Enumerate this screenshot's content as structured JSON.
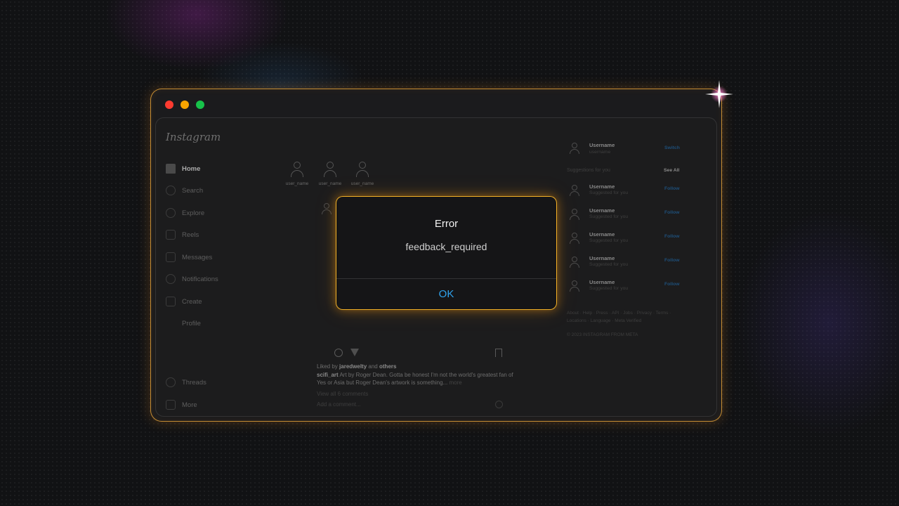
{
  "app": {
    "logo": "Instagram"
  },
  "sidebar": {
    "items": [
      {
        "label": "Home",
        "icon": "home-icon"
      },
      {
        "label": "Search",
        "icon": "search-icon"
      },
      {
        "label": "Explore",
        "icon": "compass-icon"
      },
      {
        "label": "Reels",
        "icon": "reels-icon"
      },
      {
        "label": "Messages",
        "icon": "send-icon"
      },
      {
        "label": "Notifications",
        "icon": "heart-icon"
      },
      {
        "label": "Create",
        "icon": "plus-square-icon"
      },
      {
        "label": "Profile",
        "icon": "profile-icon"
      },
      {
        "label": "Threads",
        "icon": "threads-icon"
      },
      {
        "label": "More",
        "icon": "menu-icon"
      }
    ]
  },
  "stories": [
    {
      "username": "user_name"
    },
    {
      "username": "user_name"
    },
    {
      "username": "user_name"
    }
  ],
  "post": {
    "liked_by_prefix": "Liked by",
    "liked_by_user": "jaredwelty",
    "liked_by_and": "and",
    "liked_by_others": "others",
    "caption_user": "scifi_art",
    "caption_text": "Art by Roger Dean. Gotta be honest I'm not the world's greatest fan of Yes or Asia but Roger Dean's artwork is something...",
    "caption_more": "more",
    "view_all": "View all 6 comments",
    "add_comment": "Add a comment..."
  },
  "right": {
    "current_user": {
      "name": "Username",
      "sub": "username",
      "action": "Switch"
    },
    "suggestions_title": "Suggestions for you",
    "see_all": "See All",
    "suggestions": [
      {
        "name": "Username",
        "sub": "Suggested for you",
        "action": "Follow"
      },
      {
        "name": "Username",
        "sub": "Suggested for you",
        "action": "Follow"
      },
      {
        "name": "Username",
        "sub": "Suggested for you",
        "action": "Follow"
      },
      {
        "name": "Username",
        "sub": "Suggested for you",
        "action": "Follow"
      },
      {
        "name": "Username",
        "sub": "Suggested for you",
        "action": "Follow"
      }
    ],
    "footer_links": "About · Help · Press · API · Jobs · Privacy · Terms · Locations · Language · Meta Verified",
    "copyright": "© 2023 INSTAGRAM FROM META"
  },
  "dialog": {
    "title": "Error",
    "message": "feedback_required",
    "ok_label": "OK"
  },
  "colors": {
    "accent_glow": "#ffb928",
    "ok_blue": "#2fa2ec",
    "traffic_red": "#fe3b30",
    "traffic_yellow": "#f7a400",
    "traffic_green": "#17c24a"
  }
}
